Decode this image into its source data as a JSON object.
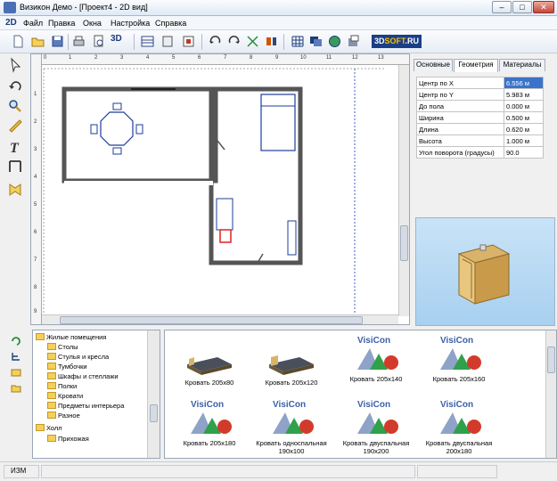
{
  "window": {
    "title": "Визикон Демо - [Проект4 - 2D вид]",
    "minimize_glyph": "–",
    "maximize_glyph": "□",
    "close_glyph": "✕"
  },
  "menubar": {
    "mode_badge": "2D",
    "items": [
      "Файл",
      "Правка",
      "Окна",
      "Настройка",
      "Справка"
    ]
  },
  "toolbar": {
    "view3d_label": "3D",
    "logo_text": "3D",
    "logo_brand": "SOFT",
    "logo_suffix": ".RU"
  },
  "rulers": {
    "h_ticks": [
      "0",
      "1",
      "2",
      "3",
      "4",
      "5",
      "6",
      "7",
      "8",
      "9",
      "10",
      "11",
      "12",
      "13"
    ],
    "v_ticks": [
      "1",
      "2",
      "3",
      "4",
      "5",
      "6",
      "7",
      "8",
      "9"
    ]
  },
  "properties": {
    "tabs": [
      "Основные",
      "Геометрия",
      "Материалы"
    ],
    "active_tab": "Геометрия",
    "rows": [
      {
        "label": "Центр по X",
        "value": "6.556 м"
      },
      {
        "label": "Центр по Y",
        "value": "5.983 м"
      },
      {
        "label": "До пола",
        "value": "0.000 м"
      },
      {
        "label": "Ширина",
        "value": "0.500 м"
      },
      {
        "label": "Длина",
        "value": "0.620 м"
      },
      {
        "label": "Высота",
        "value": "1.000 м"
      },
      {
        "label": "Угол поворота (градусы)",
        "value": "90.0"
      }
    ]
  },
  "tree": {
    "items": [
      {
        "label": "Жилые помещения",
        "level": 0
      },
      {
        "label": "Столы",
        "level": 1
      },
      {
        "label": "Стулья и кресла",
        "level": 1
      },
      {
        "label": "Тумбочки",
        "level": 1
      },
      {
        "label": "Шкафы и стеллажи",
        "level": 1
      },
      {
        "label": "Полки",
        "level": 1
      },
      {
        "label": "Кровати",
        "level": 1
      },
      {
        "label": "Предметы интерьера",
        "level": 1
      },
      {
        "label": "Разное",
        "level": 1
      },
      {
        "label": "Холл",
        "level": 0
      },
      {
        "label": "Прихожая",
        "level": 1
      }
    ]
  },
  "catalog": {
    "items": [
      {
        "caption": "Кровать 205х80",
        "thumb": "bed-icon"
      },
      {
        "caption": "Кровать 205х120",
        "thumb": "bed-icon"
      },
      {
        "caption": "Кровать 205х140",
        "thumb": "visicon-logo"
      },
      {
        "caption": "Кровать 205х160",
        "thumb": "visicon-logo"
      },
      {
        "caption": "Кровать 205х180",
        "thumb": "visicon-logo"
      },
      {
        "caption": "Кровать односпальная 190х100",
        "thumb": "visicon-logo"
      },
      {
        "caption": "Кровать двуспальная 190х200",
        "thumb": "visicon-logo"
      },
      {
        "caption": "Кровать двуспальная 200х180",
        "thumb": "visicon-logo"
      }
    ],
    "logo_word": "VisiCon"
  },
  "status": {
    "mode": "ИЗМ"
  }
}
